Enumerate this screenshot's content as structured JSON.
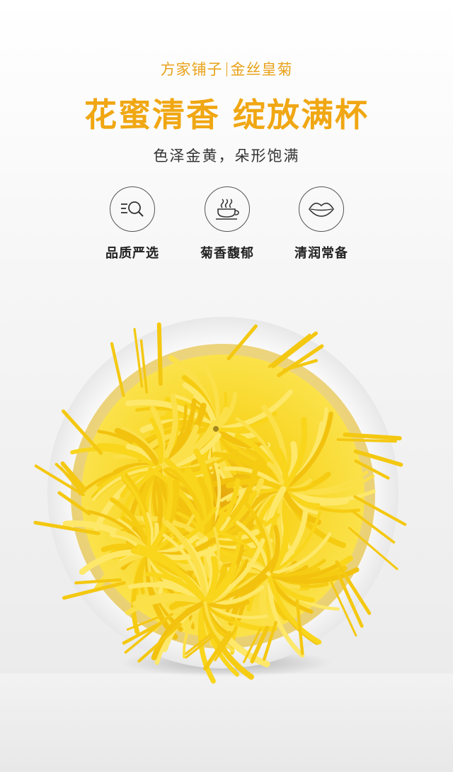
{
  "header": {
    "brand": "方家铺子",
    "product": "金丝皇菊",
    "headline": "花蜜清香 绽放满杯",
    "subline": "色泽金黄，朵形饱满"
  },
  "features": [
    {
      "label": "品质严选",
      "icon": "magnifier-list-icon"
    },
    {
      "label": "菊香馥郁",
      "icon": "tea-cup-icon"
    },
    {
      "label": "清润常备",
      "icon": "lips-icon"
    }
  ],
  "colors": {
    "accent": "#f0a713",
    "text_dark": "#333333",
    "petal_yellow": "#f6cf14",
    "bowl_white": "#ffffff"
  },
  "image": {
    "subject": "chrysanthemum-bowl"
  }
}
